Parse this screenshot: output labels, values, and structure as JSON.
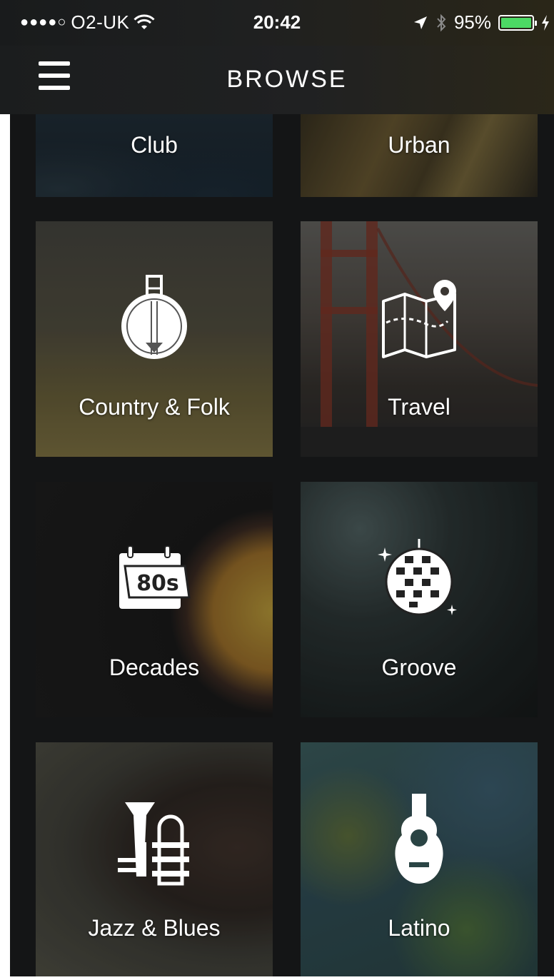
{
  "status_bar": {
    "signal_dots": "●●●●○",
    "carrier": "O2-UK",
    "time": "20:42",
    "battery_percent": "95%",
    "icons": [
      "wifi-icon",
      "location-arrow-icon",
      "bluetooth-icon",
      "battery-icon",
      "charging-icon"
    ],
    "battery_color": "#4cd964"
  },
  "nav": {
    "title": "BROWSE",
    "menu_icon": "hamburger-menu-icon"
  },
  "categories": [
    {
      "label": "Club"
    },
    {
      "label": "Urban"
    },
    {
      "label": "Country & Folk",
      "icon": "banjo-icon"
    },
    {
      "label": "Travel",
      "icon": "map-pin-icon"
    },
    {
      "label": "Decades",
      "icon": "calendar-80s-icon",
      "icon_text": "80s"
    },
    {
      "label": "Groove",
      "icon": "disco-ball-icon"
    },
    {
      "label": "Jazz & Blues",
      "icon": "trumpet-icon"
    },
    {
      "label": "Latino",
      "icon": "guitar-icon"
    }
  ]
}
